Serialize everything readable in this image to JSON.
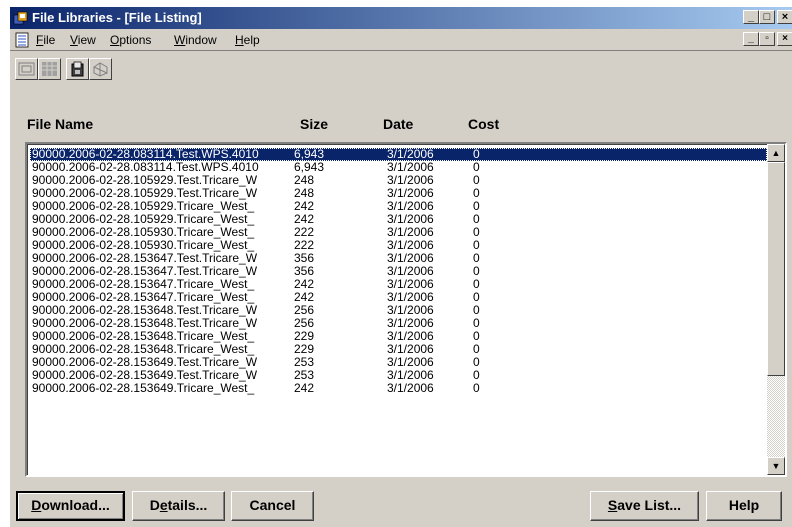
{
  "window": {
    "title": "File Libraries - [File Listing]",
    "controls": {
      "minimize": "_",
      "maximize": "□",
      "close": "×",
      "restore": "▫"
    }
  },
  "menu": {
    "items": [
      {
        "label": "File",
        "mnemonic": "F"
      },
      {
        "label": "View",
        "mnemonic": "V"
      },
      {
        "label": "Options",
        "mnemonic": "O"
      },
      {
        "label": "Window",
        "mnemonic": "W"
      },
      {
        "label": "Help",
        "mnemonic": "H"
      }
    ]
  },
  "toolbar": {
    "buttons": [
      {
        "icon": "library-icon",
        "enabled": false
      },
      {
        "icon": "grid-icon",
        "enabled": false
      },
      {
        "icon": "download-icon",
        "enabled": true
      },
      {
        "icon": "connect-icon",
        "enabled": false
      }
    ]
  },
  "list": {
    "columns": [
      "File Name",
      "Size",
      "Date",
      "Cost"
    ],
    "rows": [
      {
        "name": "90000.2006-02-28.083114.Test.WPS.4010",
        "size": "6,943",
        "date": "3/1/2006",
        "cost": "0",
        "selected": true
      },
      {
        "name": "90000.2006-02-28.083114.Test.WPS.4010",
        "size": "6,943",
        "date": "3/1/2006",
        "cost": "0"
      },
      {
        "name": "90000.2006-02-28.105929.Test.Tricare_W",
        "size": "248",
        "date": "3/1/2006",
        "cost": "0"
      },
      {
        "name": "90000.2006-02-28.105929.Test.Tricare_W",
        "size": "248",
        "date": "3/1/2006",
        "cost": "0"
      },
      {
        "name": "90000.2006-02-28.105929.Tricare_West_",
        "size": "242",
        "date": "3/1/2006",
        "cost": "0"
      },
      {
        "name": "90000.2006-02-28.105929.Tricare_West_",
        "size": "242",
        "date": "3/1/2006",
        "cost": "0"
      },
      {
        "name": "90000.2006-02-28.105930.Tricare_West_",
        "size": "222",
        "date": "3/1/2006",
        "cost": "0"
      },
      {
        "name": "90000.2006-02-28.105930.Tricare_West_",
        "size": "222",
        "date": "3/1/2006",
        "cost": "0"
      },
      {
        "name": "90000.2006-02-28.153647.Test.Tricare_W",
        "size": "356",
        "date": "3/1/2006",
        "cost": "0"
      },
      {
        "name": "90000.2006-02-28.153647.Test.Tricare_W",
        "size": "356",
        "date": "3/1/2006",
        "cost": "0"
      },
      {
        "name": "90000.2006-02-28.153647.Tricare_West_",
        "size": "242",
        "date": "3/1/2006",
        "cost": "0"
      },
      {
        "name": "90000.2006-02-28.153647.Tricare_West_",
        "size": "242",
        "date": "3/1/2006",
        "cost": "0"
      },
      {
        "name": "90000.2006-02-28.153648.Test.Tricare_W",
        "size": "256",
        "date": "3/1/2006",
        "cost": "0"
      },
      {
        "name": "90000.2006-02-28.153648.Test.Tricare_W",
        "size": "256",
        "date": "3/1/2006",
        "cost": "0"
      },
      {
        "name": "90000.2006-02-28.153648.Tricare_West_",
        "size": "229",
        "date": "3/1/2006",
        "cost": "0"
      },
      {
        "name": "90000.2006-02-28.153648.Tricare_West_",
        "size": "229",
        "date": "3/1/2006",
        "cost": "0"
      },
      {
        "name": "90000.2006-02-28.153649.Test.Tricare_W",
        "size": "253",
        "date": "3/1/2006",
        "cost": "0"
      },
      {
        "name": "90000.2006-02-28.153649.Test.Tricare_W",
        "size": "253",
        "date": "3/1/2006",
        "cost": "0"
      },
      {
        "name": "90000.2006-02-28.153649.Tricare_West_",
        "size": "242",
        "date": "3/1/2006",
        "cost": "0"
      }
    ],
    "scroll": {
      "up": "▲",
      "down": "▼"
    }
  },
  "buttons": {
    "download": {
      "label": "Download...",
      "mnemonic": "D"
    },
    "details": {
      "label": "Details...",
      "mnemonic": "e"
    },
    "cancel": {
      "label": "Cancel"
    },
    "save_list": {
      "label": "Save List...",
      "mnemonic": "S"
    },
    "help": {
      "label": "Help"
    }
  },
  "colors": {
    "title_start": "#0a246a",
    "title_end": "#a6caf0",
    "face": "#d4d0c8",
    "selection": "#0a246a"
  }
}
